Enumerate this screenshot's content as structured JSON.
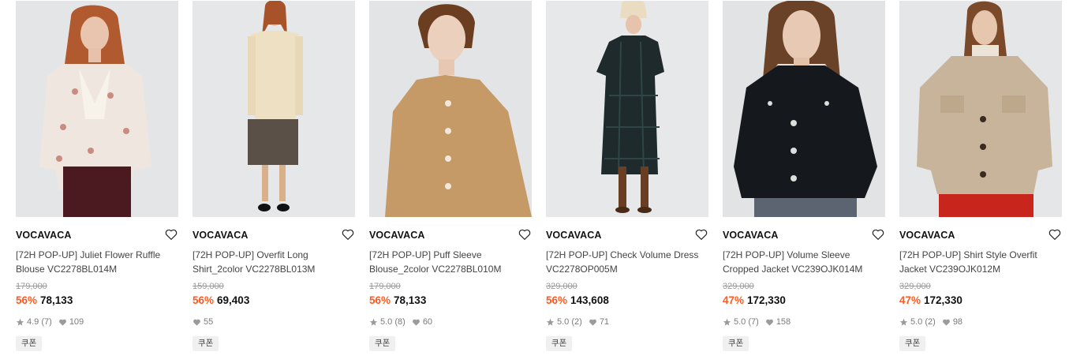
{
  "products": [
    {
      "brand": "VOCAVACA",
      "name": "[72H POP-UP] Juliet Flower Ruffle Blouse VC2278BL014M",
      "original_price": "179,000",
      "discount": "56%",
      "price": "78,133",
      "rating": "4.9",
      "review_count": "(7)",
      "likes": "109",
      "coupon": "쿠폰",
      "photo": "model-floral-ruffle-blouse"
    },
    {
      "brand": "VOCAVACA",
      "name": "[72H POP-UP] Overfit Long Shirt_2color VC2278BL013M",
      "original_price": "159,000",
      "discount": "56%",
      "price": "69,403",
      "rating": "",
      "review_count": "",
      "likes": "55",
      "coupon": "쿠폰",
      "photo": "model-cream-long-shirt"
    },
    {
      "brand": "VOCAVACA",
      "name": "[72H POP-UP] Puff Sleeve Blouse_2color VC2278BL010M",
      "original_price": "179,000",
      "discount": "56%",
      "price": "78,133",
      "rating": "5.0",
      "review_count": "(8)",
      "likes": "60",
      "coupon": "쿠폰",
      "photo": "model-camel-puff-blouse"
    },
    {
      "brand": "VOCAVACA",
      "name": "[72H POP-UP] Check Volume Dress VC2278OP005M",
      "original_price": "329,000",
      "discount": "56%",
      "price": "143,608",
      "rating": "5.0",
      "review_count": "(2)",
      "likes": "71",
      "coupon": "쿠폰",
      "photo": "model-check-dress"
    },
    {
      "brand": "VOCAVACA",
      "name": "[72H POP-UP] Volume Sleeve Cropped Jacket VC239OJK014M",
      "original_price": "329,000",
      "discount": "47%",
      "price": "172,330",
      "rating": "5.0",
      "review_count": "(7)",
      "likes": "158",
      "coupon": "쿠폰",
      "photo": "model-black-cropped-jacket"
    },
    {
      "brand": "VOCAVACA",
      "name": "[72H POP-UP] Shirt Style Overfit Jacket VC239OJK012M",
      "original_price": "329,000",
      "discount": "47%",
      "price": "172,330",
      "rating": "5.0",
      "review_count": "(2)",
      "likes": "98",
      "coupon": "쿠폰",
      "photo": "model-beige-wool-jacket"
    }
  ],
  "icons": {
    "wishlist": "heart-outline-icon",
    "rating": "star-icon",
    "likes": "heart-filled-icon"
  },
  "colors": {
    "discount": "#ff5a1f",
    "strike": "#9a9a9a",
    "meta": "#7a7a7a",
    "coupon_bg": "#f0f0f0"
  }
}
